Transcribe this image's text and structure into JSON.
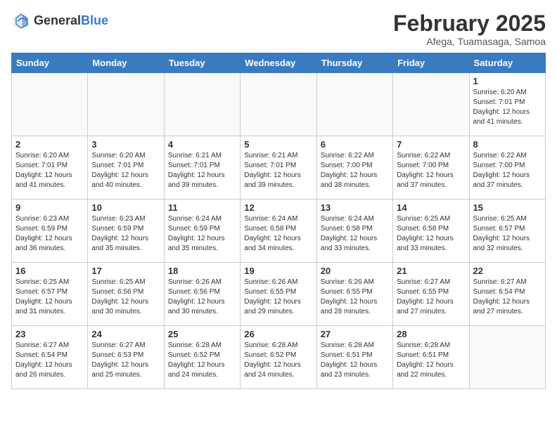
{
  "header": {
    "logo_general": "General",
    "logo_blue": "Blue",
    "month_year": "February 2025",
    "location": "Afega, Tuamasaga, Samoa"
  },
  "weekdays": [
    "Sunday",
    "Monday",
    "Tuesday",
    "Wednesday",
    "Thursday",
    "Friday",
    "Saturday"
  ],
  "weeks": [
    [
      {
        "day": "",
        "info": ""
      },
      {
        "day": "",
        "info": ""
      },
      {
        "day": "",
        "info": ""
      },
      {
        "day": "",
        "info": ""
      },
      {
        "day": "",
        "info": ""
      },
      {
        "day": "",
        "info": ""
      },
      {
        "day": "1",
        "info": "Sunrise: 6:20 AM\nSunset: 7:01 PM\nDaylight: 12 hours\nand 41 minutes."
      }
    ],
    [
      {
        "day": "2",
        "info": "Sunrise: 6:20 AM\nSunset: 7:01 PM\nDaylight: 12 hours\nand 41 minutes."
      },
      {
        "day": "3",
        "info": "Sunrise: 6:20 AM\nSunset: 7:01 PM\nDaylight: 12 hours\nand 40 minutes."
      },
      {
        "day": "4",
        "info": "Sunrise: 6:21 AM\nSunset: 7:01 PM\nDaylight: 12 hours\nand 39 minutes."
      },
      {
        "day": "5",
        "info": "Sunrise: 6:21 AM\nSunset: 7:01 PM\nDaylight: 12 hours\nand 39 minutes."
      },
      {
        "day": "6",
        "info": "Sunrise: 6:22 AM\nSunset: 7:00 PM\nDaylight: 12 hours\nand 38 minutes."
      },
      {
        "day": "7",
        "info": "Sunrise: 6:22 AM\nSunset: 7:00 PM\nDaylight: 12 hours\nand 37 minutes."
      },
      {
        "day": "8",
        "info": "Sunrise: 6:22 AM\nSunset: 7:00 PM\nDaylight: 12 hours\nand 37 minutes."
      }
    ],
    [
      {
        "day": "9",
        "info": "Sunrise: 6:23 AM\nSunset: 6:59 PM\nDaylight: 12 hours\nand 36 minutes."
      },
      {
        "day": "10",
        "info": "Sunrise: 6:23 AM\nSunset: 6:59 PM\nDaylight: 12 hours\nand 35 minutes."
      },
      {
        "day": "11",
        "info": "Sunrise: 6:24 AM\nSunset: 6:59 PM\nDaylight: 12 hours\nand 35 minutes."
      },
      {
        "day": "12",
        "info": "Sunrise: 6:24 AM\nSunset: 6:58 PM\nDaylight: 12 hours\nand 34 minutes."
      },
      {
        "day": "13",
        "info": "Sunrise: 6:24 AM\nSunset: 6:58 PM\nDaylight: 12 hours\nand 33 minutes."
      },
      {
        "day": "14",
        "info": "Sunrise: 6:25 AM\nSunset: 6:58 PM\nDaylight: 12 hours\nand 33 minutes."
      },
      {
        "day": "15",
        "info": "Sunrise: 6:25 AM\nSunset: 6:57 PM\nDaylight: 12 hours\nand 32 minutes."
      }
    ],
    [
      {
        "day": "16",
        "info": "Sunrise: 6:25 AM\nSunset: 6:57 PM\nDaylight: 12 hours\nand 31 minutes."
      },
      {
        "day": "17",
        "info": "Sunrise: 6:25 AM\nSunset: 6:56 PM\nDaylight: 12 hours\nand 30 minutes."
      },
      {
        "day": "18",
        "info": "Sunrise: 6:26 AM\nSunset: 6:56 PM\nDaylight: 12 hours\nand 30 minutes."
      },
      {
        "day": "19",
        "info": "Sunrise: 6:26 AM\nSunset: 6:55 PM\nDaylight: 12 hours\nand 29 minutes."
      },
      {
        "day": "20",
        "info": "Sunrise: 6:26 AM\nSunset: 6:55 PM\nDaylight: 12 hours\nand 28 minutes."
      },
      {
        "day": "21",
        "info": "Sunrise: 6:27 AM\nSunset: 6:55 PM\nDaylight: 12 hours\nand 27 minutes."
      },
      {
        "day": "22",
        "info": "Sunrise: 6:27 AM\nSunset: 6:54 PM\nDaylight: 12 hours\nand 27 minutes."
      }
    ],
    [
      {
        "day": "23",
        "info": "Sunrise: 6:27 AM\nSunset: 6:54 PM\nDaylight: 12 hours\nand 26 minutes."
      },
      {
        "day": "24",
        "info": "Sunrise: 6:27 AM\nSunset: 6:53 PM\nDaylight: 12 hours\nand 25 minutes."
      },
      {
        "day": "25",
        "info": "Sunrise: 6:28 AM\nSunset: 6:52 PM\nDaylight: 12 hours\nand 24 minutes."
      },
      {
        "day": "26",
        "info": "Sunrise: 6:28 AM\nSunset: 6:52 PM\nDaylight: 12 hours\nand 24 minutes."
      },
      {
        "day": "27",
        "info": "Sunrise: 6:28 AM\nSunset: 6:51 PM\nDaylight: 12 hours\nand 23 minutes."
      },
      {
        "day": "28",
        "info": "Sunrise: 6:28 AM\nSunset: 6:51 PM\nDaylight: 12 hours\nand 22 minutes."
      },
      {
        "day": "",
        "info": ""
      }
    ]
  ]
}
